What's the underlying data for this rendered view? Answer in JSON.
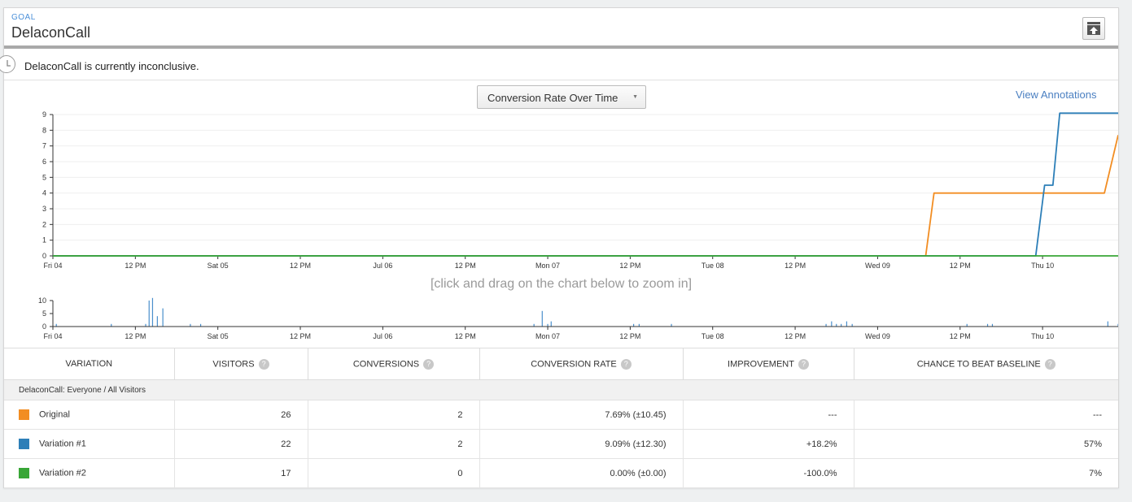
{
  "header": {
    "goal_label": "GOAL",
    "title": "DelaconCall"
  },
  "status": {
    "text": "DelaconCall is currently inconclusive."
  },
  "chart_select": {
    "label": "Conversion Rate Over Time"
  },
  "annotations_link": "View Annotations",
  "zoom_hint": "[click and drag on the chart below to zoom in]",
  "chart_data": {
    "type": "line",
    "x_ticks": [
      "Fri 04",
      "12 PM",
      "Sat 05",
      "12 PM",
      "Jul 06",
      "12 PM",
      "Mon 07",
      "12 PM",
      "Tue 08",
      "12 PM",
      "Wed 09",
      "12 PM",
      "Thu 10"
    ],
    "y_ticks": [
      "0",
      "1",
      "2",
      "3",
      "4",
      "5",
      "6",
      "7",
      "8",
      "9"
    ],
    "ylim": [
      0,
      9
    ],
    "xlim_hours": [
      0,
      155
    ],
    "series": [
      {
        "color": "#f28d22",
        "points": [
          [
            0,
            0
          ],
          [
            127,
            0
          ],
          [
            128.2,
            4
          ],
          [
            153,
            4
          ],
          [
            155,
            7.69
          ]
        ]
      },
      {
        "color": "#2d7fb8",
        "points": [
          [
            0,
            0
          ],
          [
            143,
            0
          ],
          [
            144.3,
            4.5
          ],
          [
            145.5,
            4.5
          ],
          [
            146.5,
            9.09
          ],
          [
            155,
            9.09
          ]
        ]
      },
      {
        "color": "#38a636",
        "points": [
          [
            0,
            0
          ],
          [
            155,
            0
          ]
        ]
      }
    ],
    "navigator": {
      "y_ticks": [
        "0",
        "5",
        "10"
      ],
      "ylim": [
        0,
        10
      ],
      "x_ticks": [
        "Fri 04",
        "12 PM",
        "Sat 05",
        "12 PM",
        "Jul 06",
        "12 PM",
        "Mon 07",
        "12 PM",
        "Tue 08",
        "12 PM",
        "Wed 09",
        "12 PM",
        "Thu 10"
      ],
      "bars": [
        [
          0.5,
          1
        ],
        [
          8.5,
          1
        ],
        [
          13.5,
          1
        ],
        [
          14,
          10
        ],
        [
          14.5,
          11
        ],
        [
          15.2,
          4
        ],
        [
          16,
          7
        ],
        [
          20,
          1
        ],
        [
          21.5,
          1
        ],
        [
          70,
          1
        ],
        [
          71.2,
          6
        ],
        [
          72,
          1
        ],
        [
          72.5,
          2
        ],
        [
          84.5,
          1
        ],
        [
          85.3,
          1
        ],
        [
          90,
          1
        ],
        [
          112.5,
          1
        ],
        [
          113.3,
          2
        ],
        [
          114,
          1
        ],
        [
          114.7,
          1
        ],
        [
          115.5,
          2
        ],
        [
          116.3,
          1
        ],
        [
          133,
          1
        ],
        [
          136,
          1
        ],
        [
          136.7,
          1
        ],
        [
          153.5,
          2
        ],
        [
          155,
          1
        ]
      ]
    }
  },
  "table": {
    "headers": [
      "VARIATION",
      "VISITORS",
      "CONVERSIONS",
      "CONVERSION RATE",
      "IMPROVEMENT",
      "CHANCE TO BEAT BASELINE"
    ],
    "help_icon": "?",
    "group": "DelaconCall: Everyone / All Visitors",
    "rows": [
      {
        "name": "Original",
        "color": "#f28d22",
        "visitors": "26",
        "conversions": "2",
        "rate": "7.69% (±10.45)",
        "improvement": "---",
        "chance": "---"
      },
      {
        "name": "Variation #1",
        "color": "#2d7fb8",
        "visitors": "22",
        "conversions": "2",
        "rate": "9.09% (±12.30)",
        "improvement": "+18.2%",
        "chance": "57%"
      },
      {
        "name": "Variation #2",
        "color": "#38a636",
        "visitors": "17",
        "conversions": "0",
        "rate": "0.00% (±0.00)",
        "improvement": "-100.0%",
        "chance": "7%"
      }
    ]
  }
}
